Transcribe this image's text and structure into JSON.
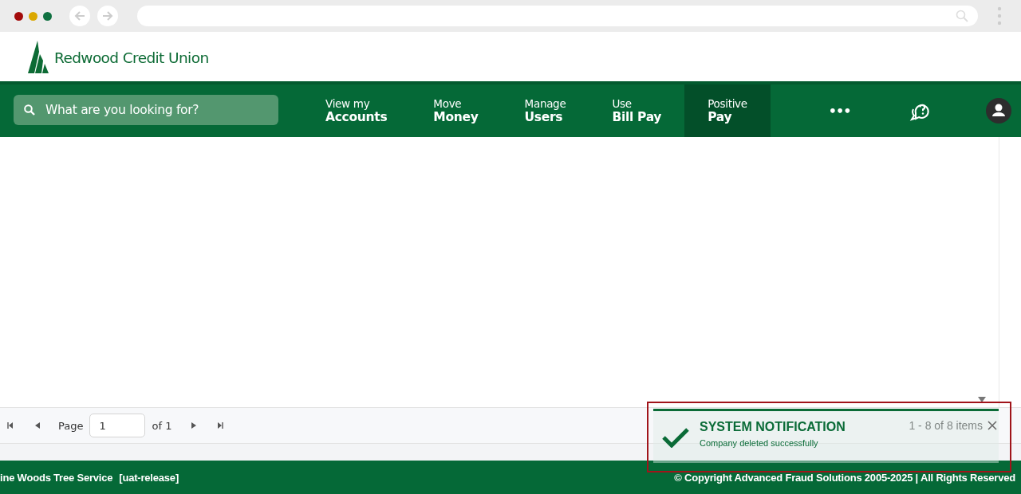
{
  "brand": {
    "name": "Redwood Credit Union"
  },
  "search": {
    "placeholder": "What are you looking for?"
  },
  "nav": {
    "items": [
      {
        "line1": "View my",
        "line2": "Accounts",
        "selected": false
      },
      {
        "line1": "Move",
        "line2": "Money",
        "selected": false
      },
      {
        "line1": "Manage",
        "line2": "Users",
        "selected": false
      },
      {
        "line1": "Use",
        "line2": "Bill Pay",
        "selected": false
      },
      {
        "line1": "Positive",
        "line2": "Pay",
        "selected": true
      }
    ],
    "more": "•••"
  },
  "pager": {
    "page_label": "Page",
    "page_value": "1",
    "of_label": "of 1",
    "items_label": "1 - 8 of 8 items"
  },
  "notification": {
    "title": "SYSTEM NOTIFICATION",
    "message": "Company deleted successfully"
  },
  "footer": {
    "company": "ine Woods Tree Service",
    "environment": "[uat-release]",
    "copyright": "© Copyright Advanced Fraud Solutions 2005-2025 | All Rights Reserved"
  }
}
